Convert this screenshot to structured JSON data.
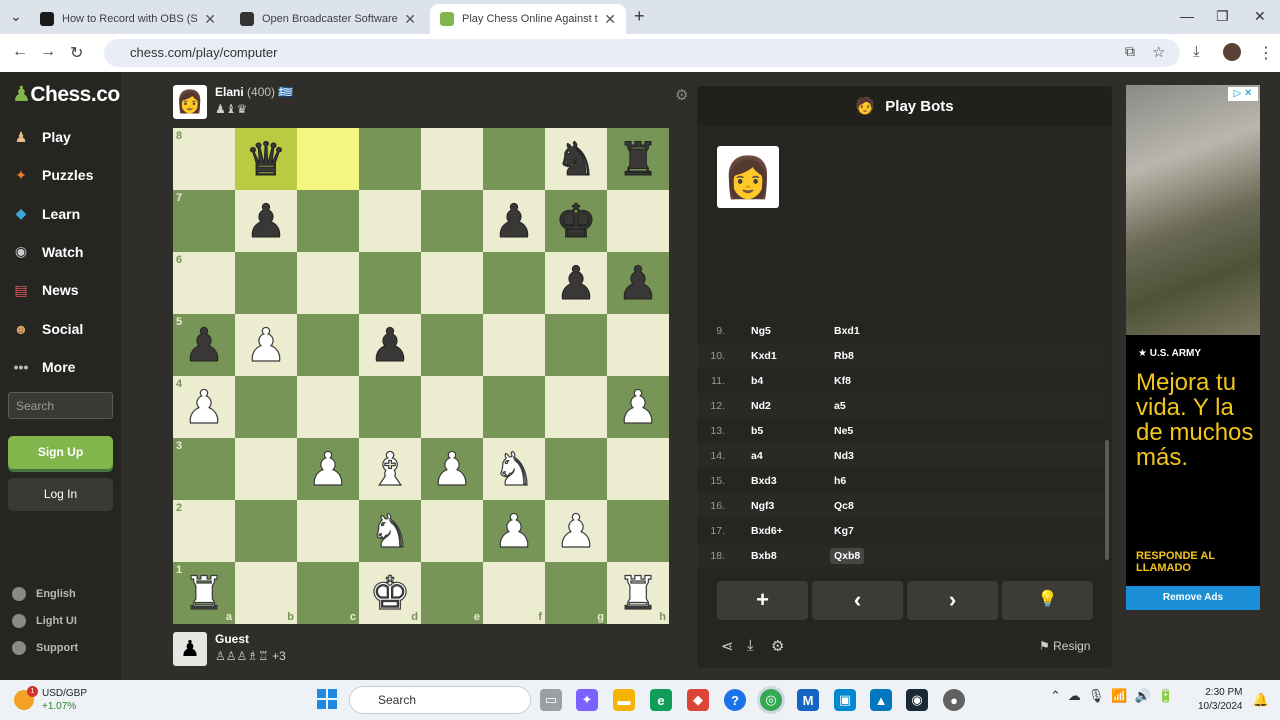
{
  "browser": {
    "tabs": [
      {
        "title": "How to Record with OBS (Step",
        "icon": "wave-icon",
        "active": false
      },
      {
        "title": "Open Broadcaster Software | O",
        "icon": "obs-icon",
        "active": false
      },
      {
        "title": "Play Chess Online Against the C",
        "icon": "chess-pawn-icon",
        "active": true
      }
    ],
    "new_tab": "+",
    "url": "chess.com/play/computer"
  },
  "sidebar": {
    "logo": "Chess.com",
    "items": [
      {
        "label": "Play",
        "icon": "play-icon",
        "glyph": "♟"
      },
      {
        "label": "Puzzles",
        "icon": "puzzle-icon",
        "glyph": "✦"
      },
      {
        "label": "Learn",
        "icon": "learn-icon",
        "glyph": "◆"
      },
      {
        "label": "Watch",
        "icon": "binoculars-icon",
        "glyph": "◉"
      },
      {
        "label": "News",
        "icon": "news-icon",
        "glyph": "▤"
      },
      {
        "label": "Social",
        "icon": "social-icon",
        "glyph": "☻"
      },
      {
        "label": "More",
        "icon": "more-icon",
        "glyph": "•••"
      }
    ],
    "search_placeholder": "Search",
    "signup": "Sign Up",
    "login": "Log In",
    "footer": [
      {
        "label": "English",
        "icon": "globe-icon"
      },
      {
        "label": "Light UI",
        "icon": "contrast-icon"
      },
      {
        "label": "Support",
        "icon": "help-icon"
      }
    ]
  },
  "top_player": {
    "name": "Elani",
    "rating": "(400)",
    "flag": "🇬🇷",
    "captured": "♟♝♛"
  },
  "bottom_player": {
    "name": "Guest",
    "captured": "♙♙♙♗♖",
    "advantage": "+3"
  },
  "board": {
    "ranks": [
      "8",
      "7",
      "6",
      "5",
      "4",
      "3",
      "2",
      "1"
    ],
    "files": [
      "a",
      "b",
      "c",
      "d",
      "e",
      "f",
      "g",
      "h"
    ],
    "highlight": [
      "b8",
      "c8"
    ],
    "position": [
      [
        "",
        "bQ",
        "",
        "",
        "",
        "",
        "bN",
        "bR"
      ],
      [
        "",
        "bP",
        "",
        "",
        "",
        "bP",
        "bK",
        ""
      ],
      [
        "",
        "",
        "",
        "",
        "",
        "",
        "bP",
        "bP"
      ],
      [
        "bP",
        "wP",
        "",
        "bP",
        "",
        "",
        "",
        ""
      ],
      [
        "wP",
        "",
        "",
        "",
        "",
        "",
        "",
        "wP"
      ],
      [
        "",
        "",
        "wP",
        "wB",
        "wP",
        "wN",
        "",
        ""
      ],
      [
        "",
        "",
        "",
        "wN",
        "",
        "wP",
        "wP",
        ""
      ],
      [
        "wR",
        "",
        "",
        "wK",
        "",
        "",
        "",
        "wR"
      ]
    ]
  },
  "panel": {
    "title": "Play Bots",
    "moves": [
      {
        "n": "9.",
        "w": "Ng5",
        "b": "Bxd1"
      },
      {
        "n": "10.",
        "w": "Kxd1",
        "b": "Rb8"
      },
      {
        "n": "11.",
        "w": "b4",
        "b": "Kf8"
      },
      {
        "n": "12.",
        "w": "Nd2",
        "b": "a5"
      },
      {
        "n": "13.",
        "w": "b5",
        "b": "Ne5"
      },
      {
        "n": "14.",
        "w": "a4",
        "b": "Nd3"
      },
      {
        "n": "15.",
        "w": "Bxd3",
        "b": "h6"
      },
      {
        "n": "16.",
        "w": "Ngf3",
        "b": "Qc8"
      },
      {
        "n": "17.",
        "w": "Bxd6+",
        "b": "Kg7"
      },
      {
        "n": "18.",
        "w": "Bxb8",
        "b": "Qxb8"
      }
    ],
    "controls": [
      "+",
      "‹",
      "›",
      "💡"
    ],
    "resign": "Resign"
  },
  "ad": {
    "brand": "★ U.S. ARMY",
    "text": "Mejora tu vida. Y la de muchos más.",
    "cta": "RESPONDE AL LLAMADO",
    "remove": "Remove Ads"
  },
  "taskbar": {
    "ticker": "USD/GBP",
    "change": "+1.07%",
    "badge": "1",
    "search_placeholder": "Search",
    "time": "2:30 PM",
    "date": "10/3/2024"
  }
}
